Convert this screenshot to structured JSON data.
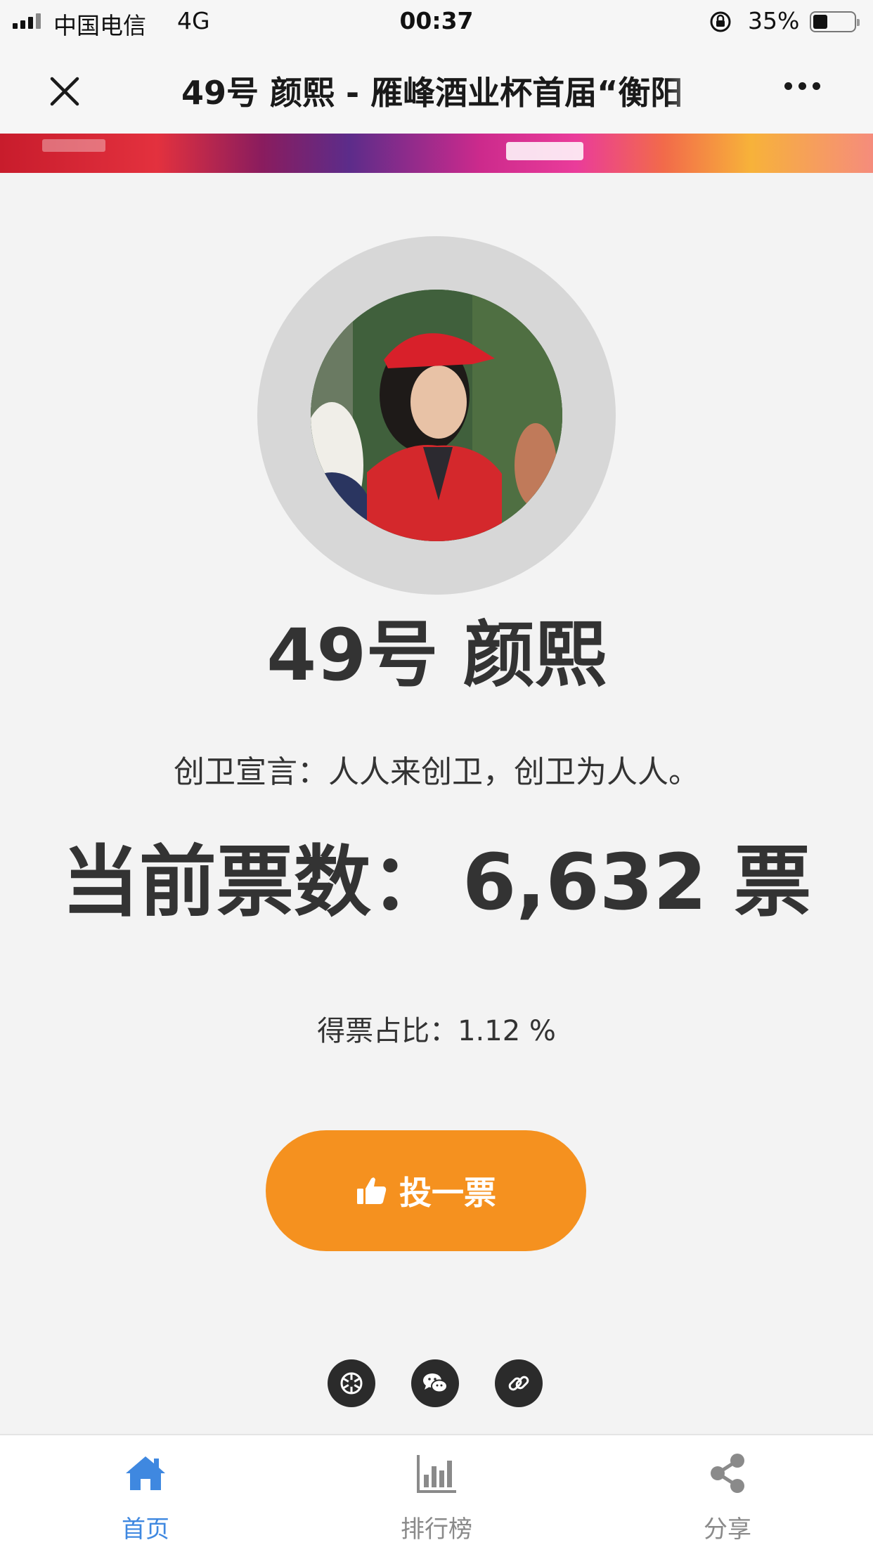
{
  "status_bar": {
    "carrier": "中国电信",
    "network": "4G",
    "time": "00:37",
    "battery_percent": "35%",
    "battery_level": 0.35
  },
  "nav": {
    "title": "49号 颜熙 - 雁峰酒业杯首届“衡阳",
    "close_icon": "close-icon",
    "more_icon": "more-icon"
  },
  "candidate": {
    "name": "49号 颜熙",
    "slogan": "创卫宣言：人人来创卫，创卫为人人。",
    "votes_label": "当前票数：",
    "votes_value": "6,632 票",
    "ratio": "得票占比：1.12 %"
  },
  "vote_button": {
    "label": "投一票",
    "icon": "thumbs-up-icon"
  },
  "share_icons": [
    "moments-icon",
    "wechat-icon",
    "link-icon"
  ],
  "tabs": [
    {
      "label": "首页",
      "icon": "home-icon",
      "active": true
    },
    {
      "label": "排行榜",
      "icon": "bar-chart-icon",
      "active": false
    },
    {
      "label": "分享",
      "icon": "share-icon",
      "active": false
    }
  ],
  "colors": {
    "accent": "#f5911f",
    "tab_active": "#3f88e0",
    "background": "#f3f3f3",
    "text": "#333333"
  }
}
